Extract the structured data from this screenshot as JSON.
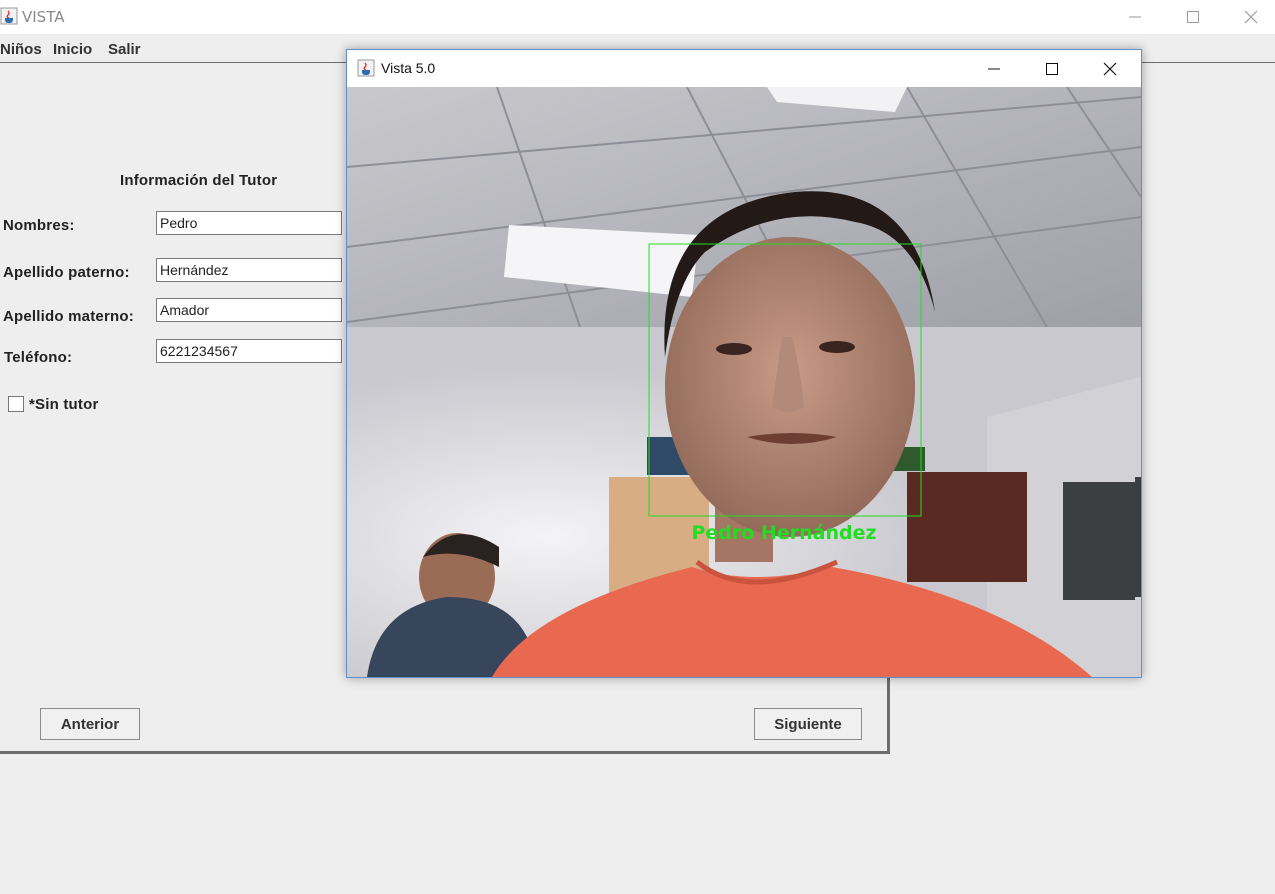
{
  "main_window": {
    "title": "VISTA",
    "menu": [
      "Niños",
      "Inicio",
      "Salir"
    ]
  },
  "form": {
    "heading": "Información del Tutor",
    "fields": [
      {
        "label": "Nombres:",
        "value": "Pedro"
      },
      {
        "label": "Apellido paterno:",
        "value": "Hernández"
      },
      {
        "label": "Apellido materno:",
        "value": "Amador"
      },
      {
        "label": "Teléfono:",
        "value": "6221234567"
      }
    ],
    "checkbox_label": "*Sin tutor",
    "checkbox_checked": false,
    "prev_button": "Anterior",
    "next_button": "Siguiente"
  },
  "camera_window": {
    "title": "Vista 5.0",
    "detected_name": "Pedro Hernández",
    "detection_color": "#22dd22"
  },
  "icons": {
    "app_icon": "java-icon",
    "minimize": "minimize-icon",
    "maximize": "maximize-icon",
    "close": "close-icon"
  }
}
